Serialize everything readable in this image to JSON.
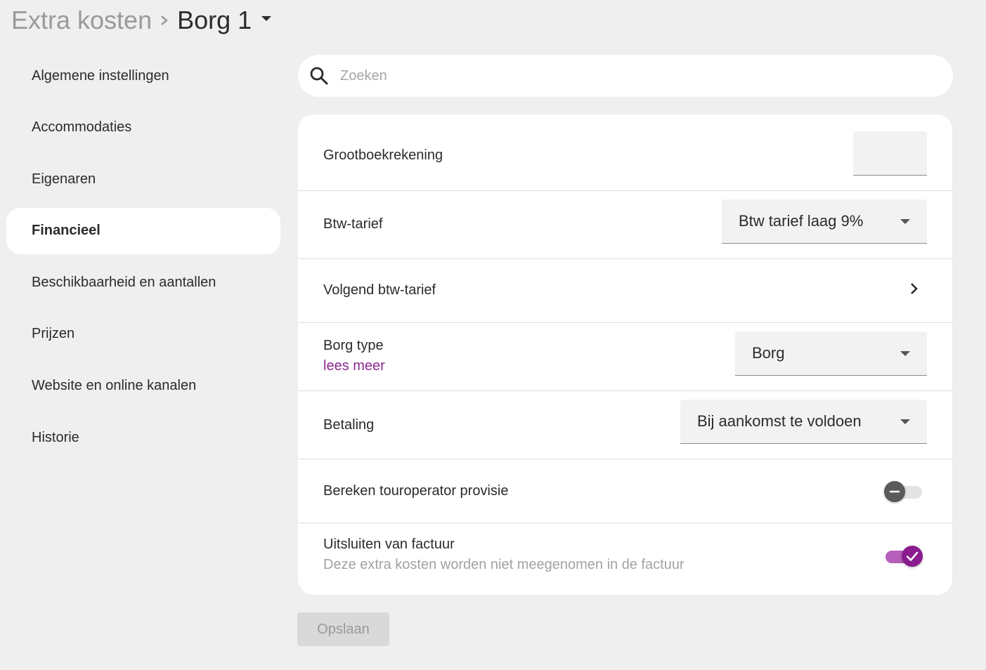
{
  "header": {
    "parent": "Extra kosten",
    "current": "Borg 1"
  },
  "sidebar": {
    "items": [
      {
        "label": "Algemene instellingen"
      },
      {
        "label": "Accommodaties"
      },
      {
        "label": "Eigenaren"
      },
      {
        "label": "Financieel",
        "active": true
      },
      {
        "label": "Beschikbaarheid en aantallen"
      },
      {
        "label": "Prijzen"
      },
      {
        "label": "Website en online kanalen"
      },
      {
        "label": "Historie"
      }
    ]
  },
  "search": {
    "placeholder": "Zoeken",
    "value": ""
  },
  "form": {
    "grootboek": {
      "label": "Grootboekrekening",
      "value": ""
    },
    "btw": {
      "label": "Btw-tarief",
      "value": "Btw tarief laag 9%"
    },
    "volgend": {
      "label": "Volgend btw-tarief"
    },
    "borgtype": {
      "label": "Borg type",
      "link": "lees meer",
      "value": "Borg"
    },
    "betaling": {
      "label": "Betaling",
      "value": "Bij aankomst te voldoen"
    },
    "provisie": {
      "label": "Bereken touroperator provisie",
      "checked": false
    },
    "uitsluiten": {
      "label": "Uitsluiten van factuur",
      "description": "Deze extra kosten worden niet meegenomen in de factuur",
      "checked": true
    }
  },
  "actions": {
    "save_label": "Opslaan"
  },
  "colors": {
    "accent": "#8a1c8f",
    "background": "#efefef"
  }
}
